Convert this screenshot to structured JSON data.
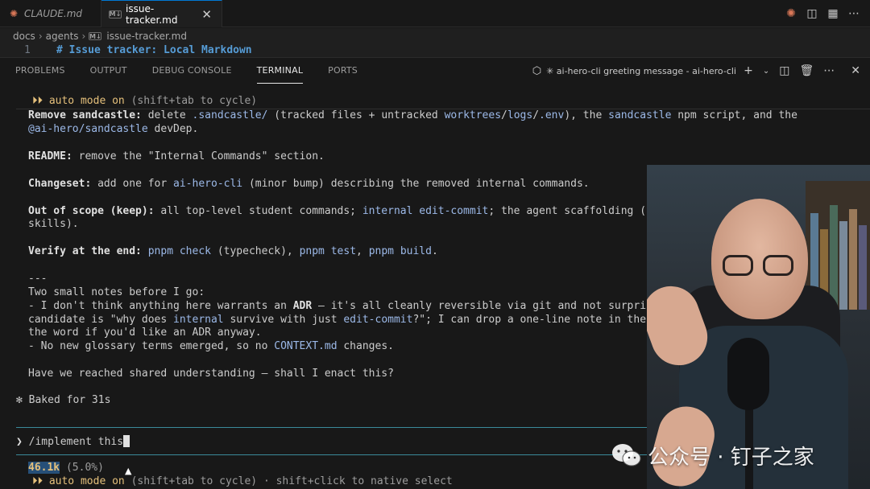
{
  "tabs": [
    {
      "label": "CLAUDE.md",
      "icon": "claude-asterisk-icon",
      "active": false
    },
    {
      "label": "issue-tracker.md",
      "icon": "markdown-file-icon",
      "active": true
    }
  ],
  "tab_actions": [
    "claude-icon",
    "split-editor-icon",
    "layout-icon",
    "more-icon"
  ],
  "breadcrumb": [
    "docs",
    "agents",
    "issue-tracker.md"
  ],
  "md_badge": "M↓",
  "editor": {
    "line_number": "1",
    "code": "# Issue tracker: Local Markdown"
  },
  "panel": {
    "tabs": [
      "PROBLEMS",
      "OUTPUT",
      "DEBUG CONSOLE",
      "TERMINAL",
      "PORTS"
    ],
    "active_tab": "TERMINAL",
    "terminal_title": "✳ ai-hero-cli greeting message - ai-hero-cli"
  },
  "terminal": {
    "auto_mode_top_arrows": "⏵⏵",
    "auto_mode_top": "auto mode on",
    "auto_mode_top_hint": "(shift+tab to cycle)",
    "remove": {
      "label": "Remove sandcastle:",
      "t1": " delete ",
      "path1": ".sandcastle/",
      "t2": " (tracked files + untracked ",
      "path2": "worktrees",
      "t3": "/",
      "path3": "logs",
      "t4": "/",
      "path4": ".env",
      "t5": "), the ",
      "script": "sandcastle",
      "t6": " npm script, and the",
      "pkg": "@ai-hero/sandcastle",
      "t7": " devDep."
    },
    "readme": {
      "label": "README:",
      "text": " remove the \"Internal Commands\" section."
    },
    "changeset": {
      "label": "Changeset:",
      "t1": " add one for ",
      "pkg": "ai-hero-cli",
      "t2": " (minor bump) describing the removed internal commands."
    },
    "scope": {
      "label": "Out of scope (keep):",
      "t1": " all top-level student commands; ",
      "cmd": "internal edit-commit",
      "t2": "; the agent scaffolding (",
      "cont": "skills)."
    },
    "verify": {
      "label": "Verify at the end:",
      "c1": "pnpm check",
      "t1": " (typecheck), ",
      "c2": "pnpm test",
      "t2": ", ",
      "c3": "pnpm build",
      "t3": "."
    },
    "rule": "---",
    "notes_intro": "Two small notes before I go:",
    "note1": {
      "t1": "- I don't think anything here warrants an ",
      "adr": "ADR",
      "t2": " — it's all cleanly reversible via git and not surpri"
    },
    "note1b": {
      "t1": "candidate is \"why does ",
      "kw": "internal",
      "t2": " survive with just ",
      "kw2": "edit-commit",
      "t3": "?\"; I can drop a one-line note in the"
    },
    "note1c": "the word if you'd like an ADR anyway.",
    "note2": {
      "t1": "- No new glossary terms emerged, so no ",
      "file": "CONTEXT.md",
      "t2": " changes."
    },
    "question": "Have we reached shared understanding — shall I enact this?",
    "baked": "✻ Baked for 31s",
    "prompt_symbol": "❯",
    "input": "/implement this",
    "tokens": "46.1k",
    "tokens_pct": " (5.0%)",
    "auto_mode_bottom_arrows": "⏵⏵",
    "auto_mode_bottom": "auto mode on",
    "auto_mode_bottom_hint": "(shift+tab to cycle) · shift+click to native select"
  },
  "watermark": {
    "text": "公众号 · 钉子之家",
    "icon": "wechat-logo-icon"
  },
  "colors": {
    "accent": "#0078d4",
    "link": "#9cb9e8",
    "auto_mode": "#e5c07b",
    "separator": "#3b8a9a"
  }
}
